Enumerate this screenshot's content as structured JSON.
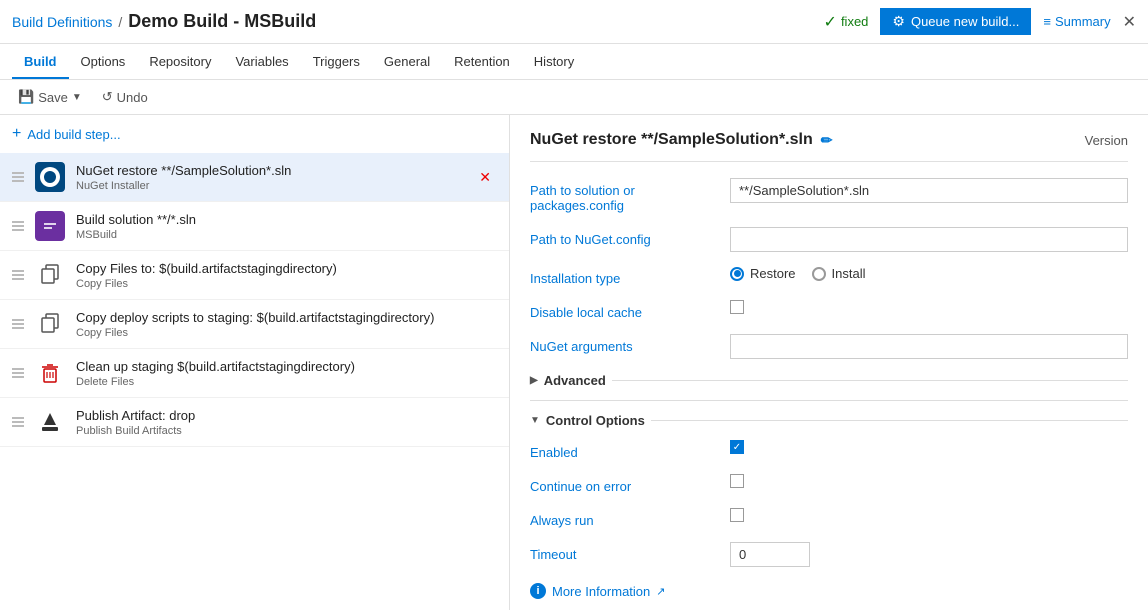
{
  "breadcrumb": {
    "link_text": "Build Definitions",
    "separator": "/",
    "current": "Demo Build - MSBuild"
  },
  "header": {
    "status_text": "fixed",
    "queue_btn_label": "Queue new build...",
    "summary_label": "Summary"
  },
  "nav": {
    "tabs": [
      {
        "id": "build",
        "label": "Build",
        "active": true
      },
      {
        "id": "options",
        "label": "Options",
        "active": false
      },
      {
        "id": "repository",
        "label": "Repository",
        "active": false
      },
      {
        "id": "variables",
        "label": "Variables",
        "active": false
      },
      {
        "id": "triggers",
        "label": "Triggers",
        "active": false
      },
      {
        "id": "general",
        "label": "General",
        "active": false
      },
      {
        "id": "retention",
        "label": "Retention",
        "active": false
      },
      {
        "id": "history",
        "label": "History",
        "active": false
      }
    ]
  },
  "toolbar": {
    "save_label": "Save",
    "undo_label": "Undo"
  },
  "left_panel": {
    "add_step_label": "Add build step...",
    "steps": [
      {
        "id": "nuget",
        "title": "NuGet restore **/SampleSolution*.sln",
        "subtitle": "NuGet Installer",
        "icon_type": "nuget",
        "active": true,
        "deletable": true
      },
      {
        "id": "msbuild",
        "title": "Build solution **/*.sln",
        "subtitle": "MSBuild",
        "icon_type": "msbuild",
        "active": false,
        "deletable": false
      },
      {
        "id": "copy1",
        "title": "Copy Files to: $(build.artifactstagingdirectory)",
        "subtitle": "Copy Files",
        "icon_type": "copy",
        "active": false,
        "deletable": false
      },
      {
        "id": "copy2",
        "title": "Copy deploy scripts to staging: $(build.artifactstagingdirectory)",
        "subtitle": "Copy Files",
        "icon_type": "copy",
        "active": false,
        "deletable": false
      },
      {
        "id": "delete",
        "title": "Clean up staging $(build.artifactstagingdirectory)",
        "subtitle": "Delete Files",
        "icon_type": "delete",
        "active": false,
        "deletable": false
      },
      {
        "id": "publish",
        "title": "Publish Artifact: drop",
        "subtitle": "Publish Build Artifacts",
        "icon_type": "publish",
        "active": false,
        "deletable": false
      }
    ]
  },
  "right_panel": {
    "title": "NuGet restore **/SampleSolution*.sln",
    "version_label": "Version",
    "fields": {
      "path_label": "Path to solution or packages.config",
      "path_value": "**/SampleSolution*.sln",
      "nuget_config_label": "Path to NuGet.config",
      "nuget_config_value": "",
      "installation_type_label": "Installation type",
      "restore_label": "Restore",
      "install_label": "Install",
      "disable_cache_label": "Disable local cache",
      "nuget_args_label": "NuGet arguments",
      "nuget_args_value": ""
    },
    "advanced": {
      "label": "Advanced"
    },
    "control_options": {
      "title": "Control Options",
      "enabled_label": "Enabled",
      "continue_error_label": "Continue on error",
      "always_run_label": "Always run",
      "timeout_label": "Timeout",
      "timeout_value": "0"
    },
    "more_info_label": "More Information"
  }
}
